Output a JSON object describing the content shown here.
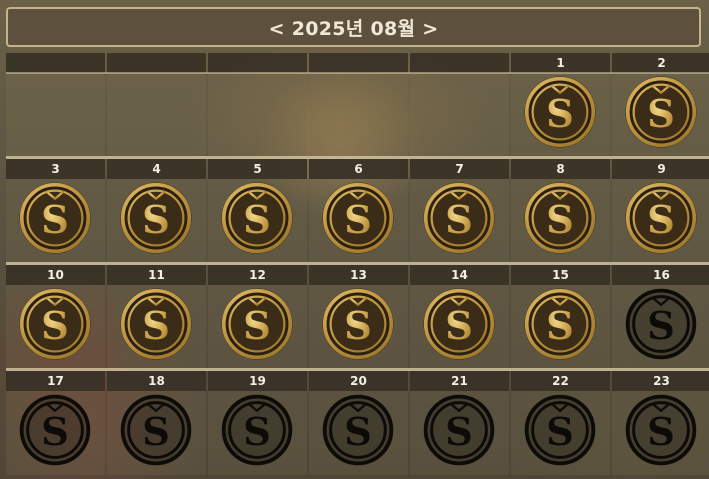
{
  "header": {
    "title": "< 2025년 08월 >"
  },
  "calendar": {
    "leading_blank_days": 5,
    "days": [
      {
        "day": "1",
        "collected": true
      },
      {
        "day": "2",
        "collected": true
      },
      {
        "day": "3",
        "collected": true
      },
      {
        "day": "4",
        "collected": true
      },
      {
        "day": "5",
        "collected": true
      },
      {
        "day": "6",
        "collected": true
      },
      {
        "day": "7",
        "collected": true
      },
      {
        "day": "8",
        "collected": true
      },
      {
        "day": "9",
        "collected": true
      },
      {
        "day": "10",
        "collected": true
      },
      {
        "day": "11",
        "collected": true
      },
      {
        "day": "12",
        "collected": true
      },
      {
        "day": "13",
        "collected": true
      },
      {
        "day": "14",
        "collected": true
      },
      {
        "day": "15",
        "collected": true
      },
      {
        "day": "16",
        "collected": false
      },
      {
        "day": "17",
        "collected": false
      },
      {
        "day": "18",
        "collected": false
      },
      {
        "day": "19",
        "collected": false
      },
      {
        "day": "20",
        "collected": false
      },
      {
        "day": "21",
        "collected": false
      },
      {
        "day": "22",
        "collected": false
      },
      {
        "day": "23",
        "collected": false
      }
    ]
  },
  "colors": {
    "coin_gold_light": "#f3d98a",
    "coin_gold_dark": "#a07a2c",
    "coin_uncollected": "#0d0b08",
    "header_border": "#c4b38a"
  },
  "icons": {
    "coin": "s-coin-icon"
  }
}
